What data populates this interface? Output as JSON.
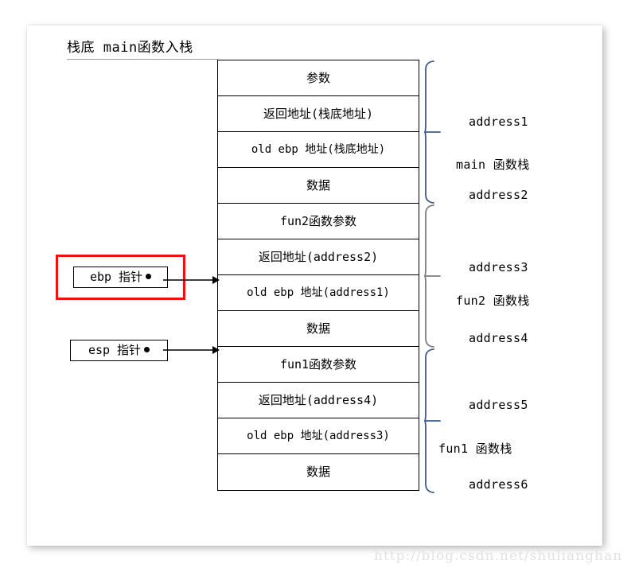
{
  "diagram": {
    "title": "栈底 main函数入栈",
    "watermark": "http://blog.csdn.net/shulianghan"
  },
  "stack": {
    "rows": [
      {
        "label": "参数"
      },
      {
        "label": "返回地址(栈底地址)"
      },
      {
        "label": "old ebp 地址(栈底地址)"
      },
      {
        "label": "数据"
      },
      {
        "label": "fun2函数参数"
      },
      {
        "label": "返回地址(address2)"
      },
      {
        "label": "old ebp 地址(address1)"
      },
      {
        "label": "数据"
      },
      {
        "label": "fun1函数参数"
      },
      {
        "label": "返回地址(address4)"
      },
      {
        "label": "old ebp 地址(address3)"
      },
      {
        "label": "数据"
      }
    ]
  },
  "frames": [
    {
      "name": "main 函数栈",
      "top_address": "address1",
      "bottom_address": "address2",
      "brace_color": "#3a5a8c"
    },
    {
      "name": "fun2 函数栈",
      "top_address": "address3",
      "bottom_address": "address4",
      "brace_color": "#7d7d7d"
    },
    {
      "name": "fun1 函数栈",
      "top_address": "address5",
      "bottom_address": "address6",
      "brace_color": "#3a5a8c"
    }
  ],
  "pointers": {
    "ebp": {
      "label": "ebp 指针",
      "highlight_color": "#ee1111"
    },
    "esp": {
      "label": "esp 指针"
    }
  }
}
